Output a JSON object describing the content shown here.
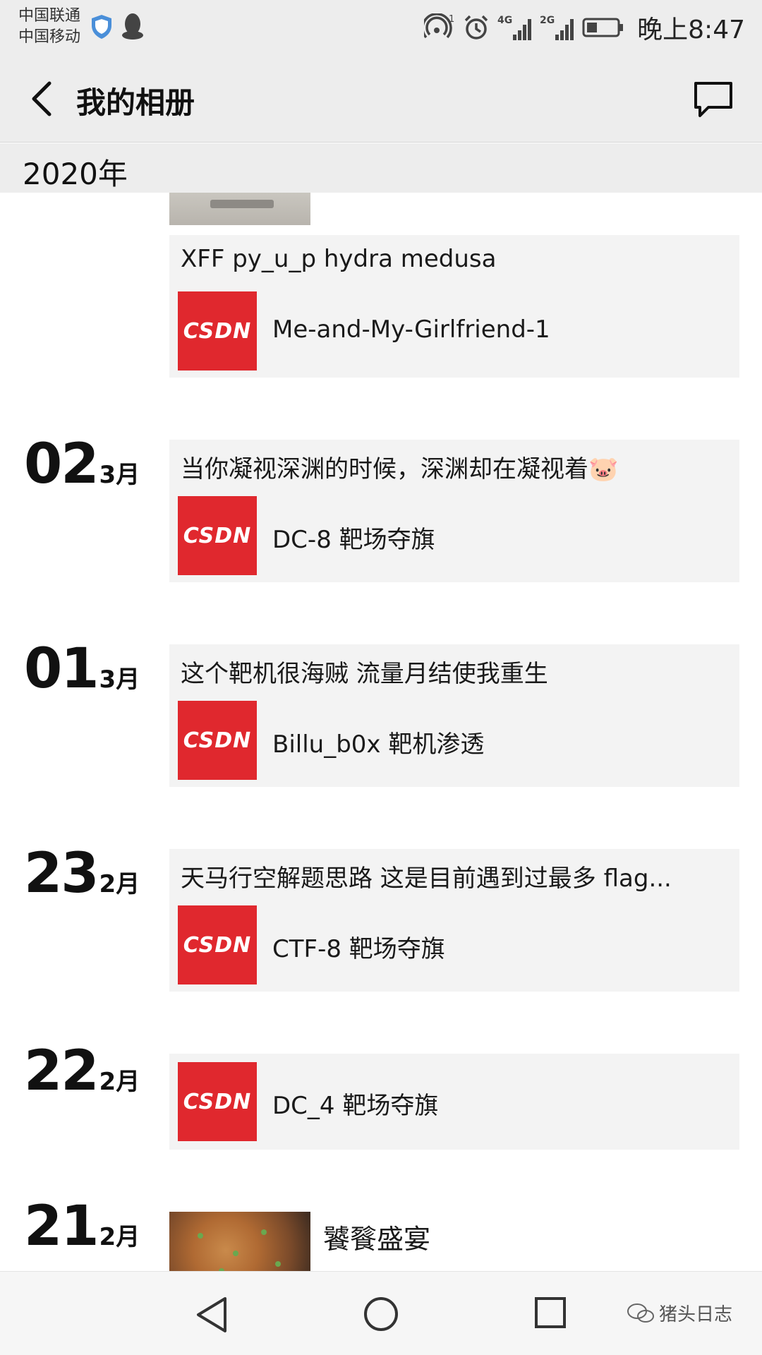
{
  "status_bar": {
    "carrier1": "中国联通",
    "carrier2": "中国移动",
    "hotspot_badge": "1",
    "net1": "4G",
    "net2": "2G",
    "time": "晚上8:47",
    "icons": [
      "shield-icon",
      "qq-penguin-icon",
      "hotspot-icon",
      "alarm-icon",
      "signal-4g-icon",
      "signal-2g-icon",
      "battery-icon"
    ]
  },
  "header": {
    "title": "我的相册",
    "back_icon": "chevron-left-icon",
    "message_icon": "message-bubble-icon"
  },
  "year_header": "2020年",
  "posts": [
    {
      "day": "",
      "month": "",
      "text": "XFF py_u_p hydra medusa",
      "link_logo": "CSDN",
      "link_title": "Me-and-My-Girlfriend-1"
    },
    {
      "day": "02",
      "month": "3月",
      "text": "当你凝视深渊的时候，深渊却在凝视着🐷",
      "link_logo": "CSDN",
      "link_title": "DC-8 靶场夺旗"
    },
    {
      "day": "01",
      "month": "3月",
      "text": "这个靶机很海贼 流量月结使我重生",
      "link_logo": "CSDN",
      "link_title": "Billu_b0x 靶机渗透"
    },
    {
      "day": "23",
      "month": "2月",
      "text": "天马行空解题思路 这是目前遇到过最多 flag...",
      "link_logo": "CSDN",
      "link_title": "CTF-8 靶场夺旗"
    },
    {
      "day": "22",
      "month": "2月",
      "text": "",
      "link_logo": "CSDN",
      "link_title": "DC_4 靶场夺旗"
    },
    {
      "day": "21",
      "month": "2月",
      "text": "饕餮盛宴"
    }
  ],
  "nav_bar": {
    "icons": [
      "nav-back-triangle-icon",
      "nav-home-circle-icon",
      "nav-recent-square-icon"
    ],
    "watermark": "猪头日志"
  }
}
